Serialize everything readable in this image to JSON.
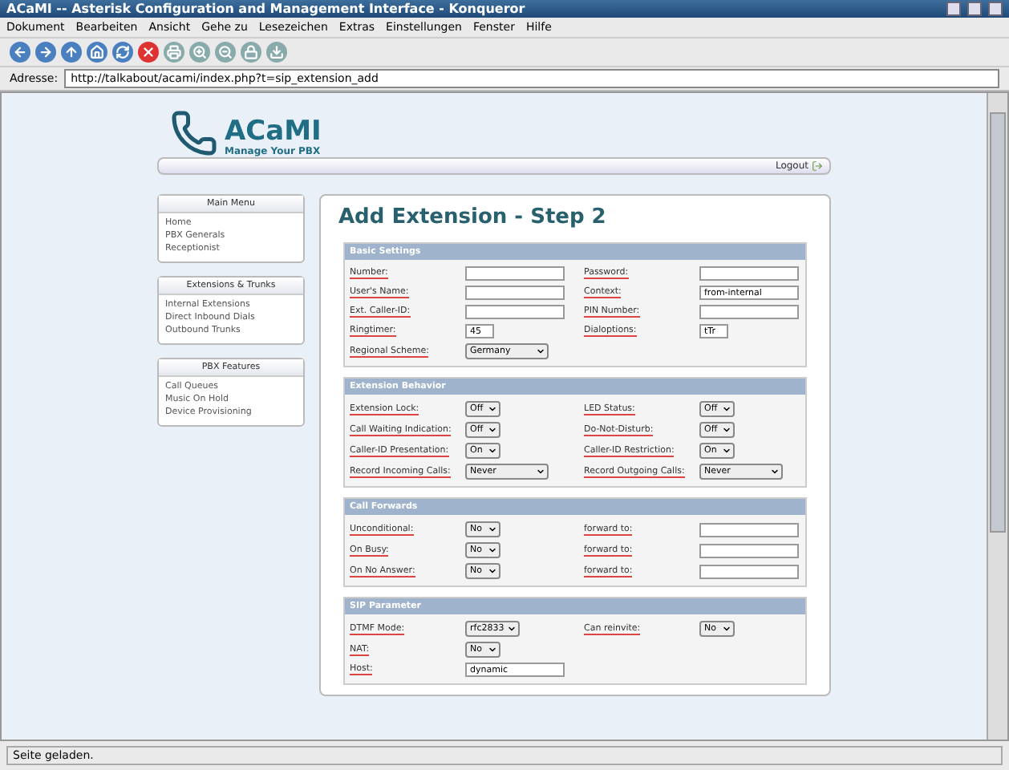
{
  "window": {
    "title": "ACaMI -- Asterisk Configuration and Management Interface - Konqueror"
  },
  "menu": [
    "Dokument",
    "Bearbeiten",
    "Ansicht",
    "Gehe zu",
    "Lesezeichen",
    "Extras",
    "Einstellungen",
    "Fenster",
    "Hilfe"
  ],
  "address": {
    "label": "Adresse:",
    "url": "http://talkabout/acami/index.php?t=sip_extension_add"
  },
  "logo": {
    "title": "ACaMI",
    "subtitle": "Manage Your PBX"
  },
  "logout": "Logout",
  "sidebar": [
    {
      "title": "Main Menu",
      "items": [
        "Home",
        "PBX Generals",
        "Receptionist"
      ]
    },
    {
      "title": "Extensions & Trunks",
      "items": [
        "Internal Extensions",
        "Direct Inbound Dials",
        "Outbound Trunks"
      ]
    },
    {
      "title": "PBX Features",
      "items": [
        "Call Queues",
        "Music On Hold",
        "Device Provisioning"
      ]
    }
  ],
  "heading": "Add Extension - Step 2",
  "sections": [
    {
      "title": "Basic Settings",
      "rows": [
        [
          {
            "label": "Number:",
            "field": {
              "kind": "text"
            }
          },
          {
            "label": "Password:",
            "field": {
              "kind": "text"
            }
          }
        ],
        [
          {
            "label": "User's Name:",
            "field": {
              "kind": "text"
            }
          },
          {
            "label": "Context:",
            "field": {
              "kind": "text",
              "value": "from-internal"
            }
          }
        ],
        [
          {
            "label": "Ext. Caller-ID:",
            "field": {
              "kind": "text"
            }
          },
          {
            "label": "PIN Number:",
            "field": {
              "kind": "text"
            }
          }
        ],
        [
          {
            "label": "Ringtimer:",
            "field": {
              "kind": "smalltext",
              "value": "45"
            }
          },
          {
            "label": "Dialoptions:",
            "field": {
              "kind": "smalltext",
              "value": "tTr"
            }
          }
        ],
        [
          {
            "label": "Regional Scheme:",
            "field": {
              "kind": "select",
              "value": "Germany"
            }
          }
        ]
      ]
    },
    {
      "title": "Extension Behavior",
      "rows": [
        [
          {
            "label": "Extension Lock:",
            "field": {
              "kind": "smallselect",
              "value": "Off"
            }
          },
          {
            "label": "LED Status:",
            "field": {
              "kind": "smallselect",
              "value": "Off"
            }
          }
        ],
        [
          {
            "label": "Call Waiting Indication:",
            "field": {
              "kind": "smallselect",
              "value": "Off"
            }
          },
          {
            "label": "Do-Not-Disturb:",
            "field": {
              "kind": "smallselect",
              "value": "Off"
            }
          }
        ],
        [
          {
            "label": "Caller-ID Presentation:",
            "field": {
              "kind": "smallselect",
              "value": "On"
            }
          },
          {
            "label": "Caller-ID Restriction:",
            "field": {
              "kind": "smallselect",
              "value": "On"
            }
          }
        ],
        [
          {
            "label": "Record Incoming Calls:",
            "field": {
              "kind": "select",
              "value": "Never"
            }
          },
          {
            "label": "Record Outgoing Calls:",
            "field": {
              "kind": "select",
              "value": "Never"
            }
          }
        ]
      ]
    },
    {
      "title": "Call Forwards",
      "rows": [
        [
          {
            "label": "Unconditional:",
            "field": {
              "kind": "smallselect",
              "value": "No"
            }
          },
          {
            "label": "forward to:",
            "field": {
              "kind": "text"
            }
          }
        ],
        [
          {
            "label": "On Busy:",
            "field": {
              "kind": "smallselect",
              "value": "No"
            }
          },
          {
            "label": "forward to:",
            "field": {
              "kind": "text"
            }
          }
        ],
        [
          {
            "label": "On No Answer:",
            "field": {
              "kind": "smallselect",
              "value": "No"
            }
          },
          {
            "label": "forward to:",
            "field": {
              "kind": "text"
            }
          }
        ]
      ]
    },
    {
      "title": "SIP Parameter",
      "rows": [
        [
          {
            "label": "DTMF Mode:",
            "field": {
              "kind": "smallselect",
              "value": "rfc2833"
            }
          },
          {
            "label": "Can reinvite:",
            "field": {
              "kind": "smallselect",
              "value": "No"
            }
          }
        ],
        [
          {
            "label": "NAT:",
            "field": {
              "kind": "smallselect",
              "value": "No"
            }
          }
        ],
        [
          {
            "label": "Host:",
            "field": {
              "kind": "text",
              "value": "dynamic"
            }
          }
        ]
      ]
    }
  ],
  "status_bar": "Seite geladen."
}
